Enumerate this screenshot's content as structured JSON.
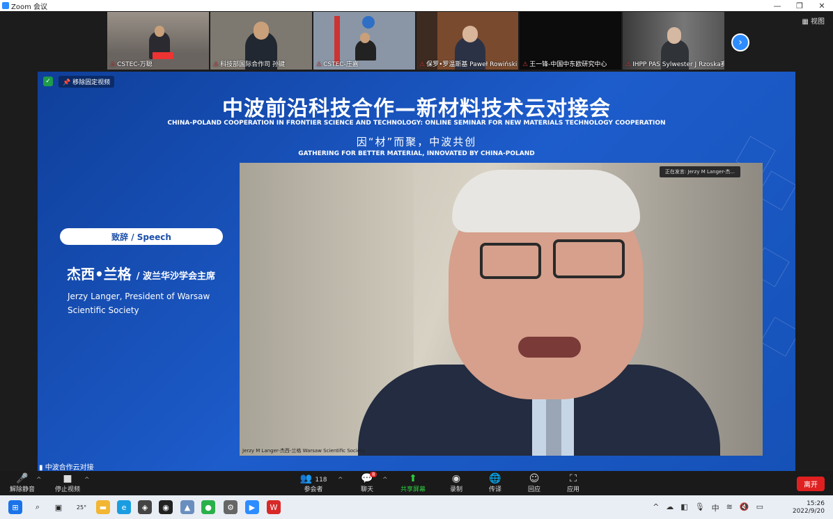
{
  "window": {
    "title": "Zoom 会议",
    "min": "—",
    "restore": "❐",
    "close": "✕"
  },
  "gallery": {
    "tiles": [
      {
        "name": "CSTEC-万聪",
        "bg": "#6a6460"
      },
      {
        "name": "科技部国际合作司 孙键",
        "bg": "#7d7870"
      },
      {
        "name": "CSTEC-庄嘉",
        "bg": "#8a96a6"
      },
      {
        "name": "保罗•罗温斯基 Paweł Rowiński",
        "bg": "#7a4a2e"
      },
      {
        "name": "王一锋-中国中东欧研究中心",
        "bg": "#0c0c0c"
      },
      {
        "name": "IHPP PAS Sylwester J Rzoska赛...",
        "bg": "#5a5a5a"
      }
    ],
    "next_icon": "chevron-right-icon",
    "view_label": "视图"
  },
  "stage": {
    "unpin_label": "移除固定视频",
    "title_cn": "中波前沿科技合作—新材料技术云对接会",
    "title_en": "CHINA-POLAND COOPERATION IN FRONTIER SCIENCE AND TECHNOLOGY: ONLINE SEMINAR FOR NEW MATERIALS TECHNOLOGY COOPERATION",
    "subtitle_cn": "因“材”而聚，中波共创",
    "subtitle_en": "GATHERING FOR BETTER MATERIAL, INNOVATED BY CHINA-POLAND",
    "speech_label": "致辞 / Speech",
    "speaker_name_cn": "杰西•兰格",
    "speaker_role_cn": "/ 波兰华沙学会主席",
    "speaker_en": "Jerzy Langer, President of Warsaw Scientific Society",
    "speaking_tag": "正在发言: Jerzy M Langer-杰...",
    "video_label": "Jerzy M Langer-杰西-兰格 Warsaw Scientific Society",
    "meeting_label": "中波合作云对接"
  },
  "toolbar": {
    "unmute": "解除静音",
    "stop_video": "停止视频",
    "participants": "参会者",
    "participants_count": "118",
    "chat": "聊天",
    "chat_badge": "8",
    "share": "共享屏幕",
    "record": "录制",
    "translate": "传译",
    "reactions": "回应",
    "apps": "应用",
    "leave": "离开"
  },
  "taskbar": {
    "weather": "25°",
    "ime": "中",
    "time": "15:26",
    "date": "2022/9/20"
  }
}
